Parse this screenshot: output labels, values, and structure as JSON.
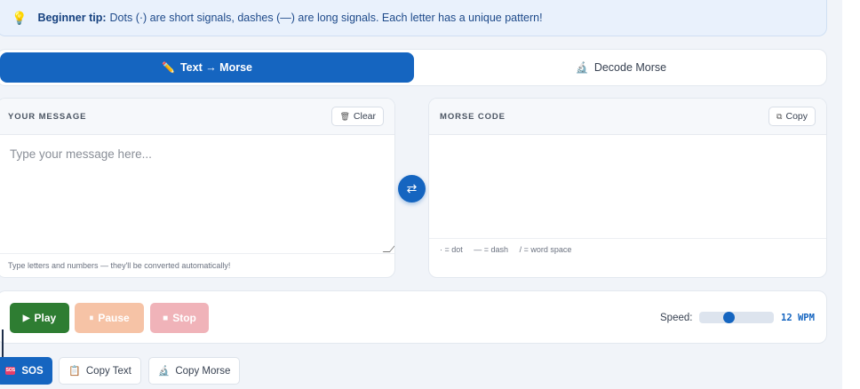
{
  "tip": {
    "icon": "lightbulb-icon",
    "label": "Beginner tip:",
    "text": "Dots (·) are short signals, dashes (—) are long signals. Each letter has a unique pattern!"
  },
  "tabs": [
    {
      "label": "Text → Morse",
      "icon": "pencil-icon",
      "active": true
    },
    {
      "label": "Decode Morse",
      "icon": "microscope-icon",
      "active": false
    }
  ],
  "input_panel": {
    "title": "YOUR MESSAGE",
    "clear_label": "Clear",
    "placeholder": "Type your message here...",
    "hint": "Type letters and numbers — they'll be converted automatically!"
  },
  "output_panel": {
    "title": "MORSE CODE",
    "copy_label": "Copy",
    "legend": [
      "· = dot",
      "— = dash",
      "/ = word space"
    ]
  },
  "swap": {
    "icon": "swap-icon"
  },
  "controls": {
    "play_label": "Play",
    "pause_label": "Pause",
    "stop_label": "Stop",
    "speed_label": "Speed:",
    "speed_value": 12,
    "speed_text": "12 WPM"
  },
  "extras": {
    "sos_label": "SOS",
    "copy_text_label": "Copy Text",
    "copy_morse_label": "Copy Morse"
  },
  "colors": {
    "accent": "#1565c0",
    "play": "#2e7d32",
    "pause": "#f6c3a6",
    "stop": "#f0b3b9",
    "tip_bg": "#e9f1fc"
  }
}
